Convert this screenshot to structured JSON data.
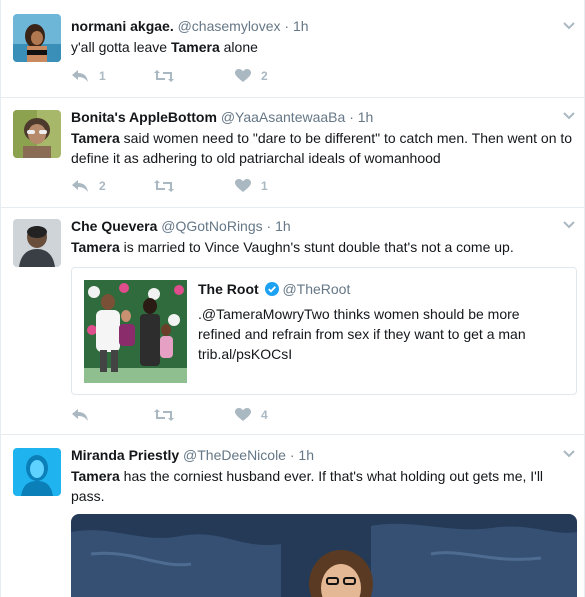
{
  "tweets": [
    {
      "fullname": "normani akgae.",
      "username": "@chasemylovex",
      "dot": "·",
      "time": "1h",
      "text_parts": [
        "y'all gotta leave ",
        "Tamera",
        " alone"
      ],
      "replies": "1",
      "retweets": "",
      "likes": "2"
    },
    {
      "fullname": "Bonita's AppleBottom",
      "username": "@YaaAsantewaaBa",
      "dot": "·",
      "time": "1h",
      "text_parts": [
        "",
        "Tamera",
        " said women need to \"dare to be different\" to catch men. Then went on to define it as adhering to old patriarchal ideals of womanhood"
      ],
      "replies": "2",
      "retweets": "",
      "likes": "1"
    },
    {
      "fullname": "Che Quevera",
      "username": "@QGotNoRings",
      "dot": "·",
      "time": "1h",
      "text_parts": [
        "",
        "Tamera",
        " is married to Vince Vaughn's stunt double that's not a come up."
      ],
      "replies": "",
      "retweets": "",
      "likes": "4",
      "quote": {
        "fullname": "The Root",
        "username": "@TheRoot",
        "text_line1": ".@TameraMowryTwo thinks women should be more",
        "text_line2": "refined and refrain from sex if they want to get a man",
        "link": "trib.al/psKOCsI"
      }
    },
    {
      "fullname": "Miranda Priestly",
      "username": "@TheDeeNicole",
      "dot": "·",
      "time": "1h",
      "text_parts": [
        "",
        "Tamera",
        " has the corniest husband ever. If that's what holding out gets me, I'll pass."
      ]
    }
  ],
  "icons": {
    "reply": "reply-icon",
    "retweet": "retweet-icon",
    "like": "heart-icon",
    "caret": "chevron-down-icon",
    "verified": "verified-badge-icon"
  },
  "colors": {
    "text": "#14171a",
    "secondary": "#657786",
    "action": "#aab8c2",
    "border": "#e6ecf0",
    "verified": "#1da1f2"
  }
}
